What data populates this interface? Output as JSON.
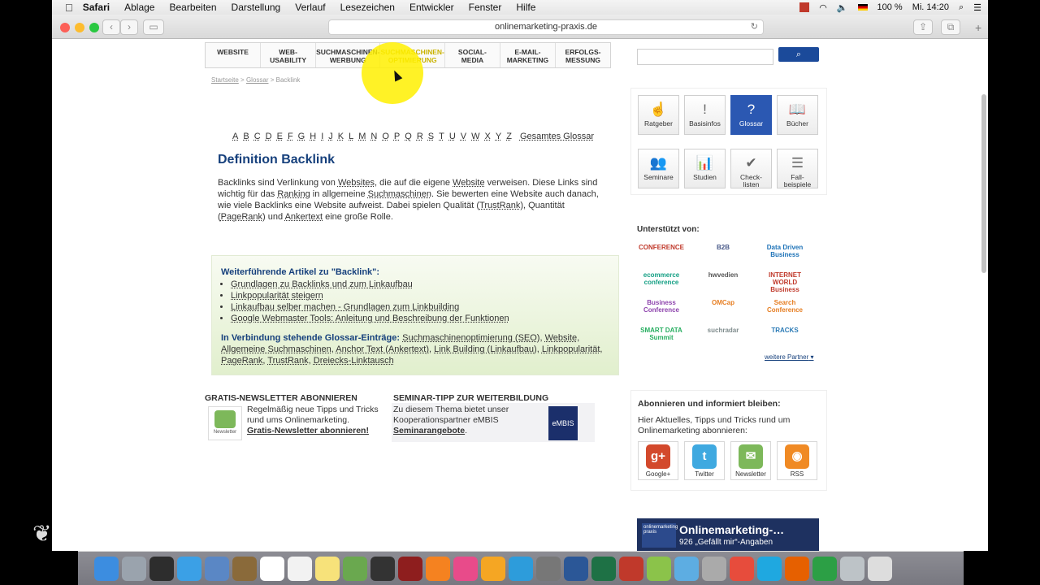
{
  "menubar": {
    "app": "Safari",
    "items": [
      "Ablage",
      "Bearbeiten",
      "Darstellung",
      "Verlauf",
      "Lesezeichen",
      "Entwickler",
      "Fenster",
      "Hilfe"
    ],
    "battery": "100 %",
    "clock": "Mi. 14:20"
  },
  "browser": {
    "url": "onlinemarketing-praxis.de"
  },
  "nav": {
    "items": [
      {
        "line1": "Website",
        "line2": ""
      },
      {
        "line1": "Web-",
        "line2": "Usability"
      },
      {
        "line1": "Suchmaschinen-",
        "line2": "werbung"
      },
      {
        "line1": "Suchmaschinen-",
        "line2": "optimierung"
      },
      {
        "line1": "Social-",
        "line2": "Media"
      },
      {
        "line1": "E-Mail-",
        "line2": "Marketing"
      },
      {
        "line1": "Erfolgs-",
        "line2": "messung"
      }
    ]
  },
  "breadcrumb": {
    "home": "Startseite",
    "sep": ">",
    "glossar": "Glossar",
    "current": "Backlink"
  },
  "search": {
    "button_icon": "search-icon"
  },
  "alphabet": [
    "A",
    "B",
    "C",
    "D",
    "E",
    "F",
    "G",
    "H",
    "I",
    "J",
    "K",
    "L",
    "M",
    "N",
    "O",
    "P",
    "Q",
    "R",
    "S",
    "T",
    "U",
    "V",
    "W",
    "X",
    "Y",
    "Z"
  ],
  "alphabet_all": "Gesamtes Glossar",
  "article": {
    "title": "Definition Backlink",
    "body_1": "Backlinks sind Verlinkung von ",
    "link_websites": "Websites",
    "body_2": ", die auf die eigene ",
    "link_website": "Website",
    "body_3": " verweisen. Diese Links sind wichtig für das ",
    "link_ranking": "Ranking",
    "body_4": " in allgemeine ",
    "link_suchmaschinen": "Suchmaschinen",
    "body_5": ". Sie bewerten eine Website auch danach, wie viele Backlinks eine Website aufweist. Dabei spielen Qualität (",
    "link_trustrank": "TrustRank",
    "body_6": "), Quantität (",
    "link_pagerank": "PageRank",
    "body_7": ") und ",
    "link_ankertext": "Ankertext",
    "body_8": " eine große Rolle."
  },
  "related": {
    "title": "Weiterführende Artikel zu \"Backlink\":",
    "links": [
      "Grundlagen zu Backlinks und zum Linkaufbau",
      "Linkpopularität steigern",
      "Linkaufbau selber machen - Grundlagen zum Linkbuilding",
      "Google Webmaster Tools: Anleitung und Beschreibung der Funktionen"
    ],
    "glossar_title": "In Verbindung stehende Glossar-Einträge:",
    "glossar_entries": [
      "Suchmaschinenoptimierung (SEO)",
      "Website",
      "Allgemeine Suchmaschinen",
      "Anchor Text (Ankertext)",
      "Link Building (Linkaufbau)",
      "Linkpopularität",
      "PageRank",
      "TrustRank",
      "Dreiecks-Linktausch"
    ]
  },
  "newsletter": {
    "title": "Gratis-Newsletter abonnieren",
    "icon_label": "Newsletter",
    "text": "Regelmäßig neue Tipps und Tricks rund ums Onlinemarketing.",
    "link": "Gratis-Newsletter abonnieren!"
  },
  "seminar": {
    "title": "Seminar-Tipp zur Weiterbildung",
    "text": "Zu diesem Thema bietet unser Kooperationspartner eMBIS",
    "link": "Seminarangebote",
    "logo": "eMBIS"
  },
  "tiles": [
    {
      "label": "Ratgeber",
      "icon": "guide-icon",
      "glyph": "☝"
    },
    {
      "label": "Basisinfos",
      "icon": "exclamation-icon",
      "glyph": "!"
    },
    {
      "label": "Glossar",
      "icon": "question-icon",
      "glyph": "?"
    },
    {
      "label": "Bücher",
      "icon": "book-icon",
      "glyph": "📖"
    },
    {
      "label": "Seminare",
      "icon": "seminar-icon",
      "glyph": "👥"
    },
    {
      "label": "Studien",
      "icon": "study-icon",
      "glyph": "📊"
    },
    {
      "label": "Check-\nlisten",
      "icon": "check-icon",
      "glyph": "✔"
    },
    {
      "label": "Fall-\nbeispiele",
      "icon": "list-icon",
      "glyph": "☰"
    }
  ],
  "supporters": {
    "title": "Unterstützt von:",
    "logos": [
      "CONFERENCE",
      "B2B",
      "Data Driven Business",
      "ecommerce conference",
      "hwvedien",
      "INTERNET WORLD Business",
      "Business Conference",
      "OMCap",
      "Search Conference",
      "SMART DATA Summit",
      "suchradar",
      "TRACKS"
    ],
    "more": "weitere Partner"
  },
  "subscribe": {
    "title": "Abonnieren und informiert bleiben:",
    "text": "Hier Aktuelles, Tipps und Tricks rund um Onlinemarketing abonnieren:",
    "items": [
      {
        "label": "Google+",
        "glyph": "g+",
        "color": "#d3492c"
      },
      {
        "label": "Twitter",
        "glyph": "t",
        "color": "#3fa9e0"
      },
      {
        "label": "Newsletter",
        "glyph": "✉",
        "color": "#7db85a"
      },
      {
        "label": "RSS",
        "glyph": "◉",
        "color": "#f08a24"
      }
    ]
  },
  "banner": {
    "title": "Onlinemarketing-…",
    "subtitle": "926 „Gefällt mir“-Angaben",
    "logo": "onlinemarketing praxis"
  },
  "colors": {
    "brand_blue": "#16407c",
    "active_tile": "#2b58b2",
    "highlight": "#fff000"
  }
}
